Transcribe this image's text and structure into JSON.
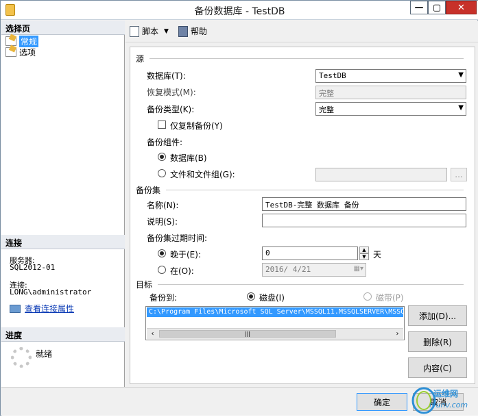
{
  "window": {
    "title": "备份数据库 - TestDB",
    "minimize": "—",
    "maximize": "▢",
    "close": "✕"
  },
  "left": {
    "select_page_heading": "选择页",
    "pages": [
      {
        "label": "常规",
        "selected": true
      },
      {
        "label": "选项",
        "selected": false
      }
    ],
    "connection_heading": "连接",
    "server_label": "服务器:",
    "server_value": "SQL2012-01",
    "connection_label": "连接:",
    "connection_value": "LONG\\administrator",
    "view_conn_props": "查看连接属性",
    "progress_heading": "进度",
    "progress_status": "就绪"
  },
  "toolbar": {
    "script_label": "脚本",
    "help_label": "帮助"
  },
  "source": {
    "heading": "源",
    "database_label": "数据库(T):",
    "database_value": "TestDB",
    "recovery_label": "恢复模式(M):",
    "recovery_value": "完整",
    "backup_type_label": "备份类型(K):",
    "backup_type_value": "完整",
    "copy_only_label": "仅复制备份(Y)",
    "component_label": "备份组件:",
    "component_db_label": "数据库(B)",
    "component_files_label": "文件和文件组(G):",
    "browse_label": "..."
  },
  "backup_set": {
    "heading": "备份集",
    "name_label": "名称(N):",
    "name_value": "TestDB-完整 数据库 备份",
    "desc_label": "说明(S):",
    "desc_value": "",
    "expire_label": "备份集过期时间:",
    "after_label": "晚于(E):",
    "after_value": "0",
    "days_label": "天",
    "on_label": "在(O):",
    "on_value": "2016/ 4/21"
  },
  "destination": {
    "heading": "目标",
    "backup_to_label": "备份到:",
    "disk_label": "磁盘(I)",
    "tape_label": "磁带(P)",
    "paths": [
      "C:\\Program Files\\Microsoft SQL Server\\MSSQL11.MSSQLSERVER\\MSSQL"
    ],
    "add_button": "添加(D)...",
    "remove_button": "删除(R)",
    "contents_button": "内容(C)"
  },
  "footer": {
    "ok_button": "确定",
    "cancel_button": "取消"
  },
  "watermark": {
    "line1": "运维网",
    "line2": "iyunv.com"
  }
}
